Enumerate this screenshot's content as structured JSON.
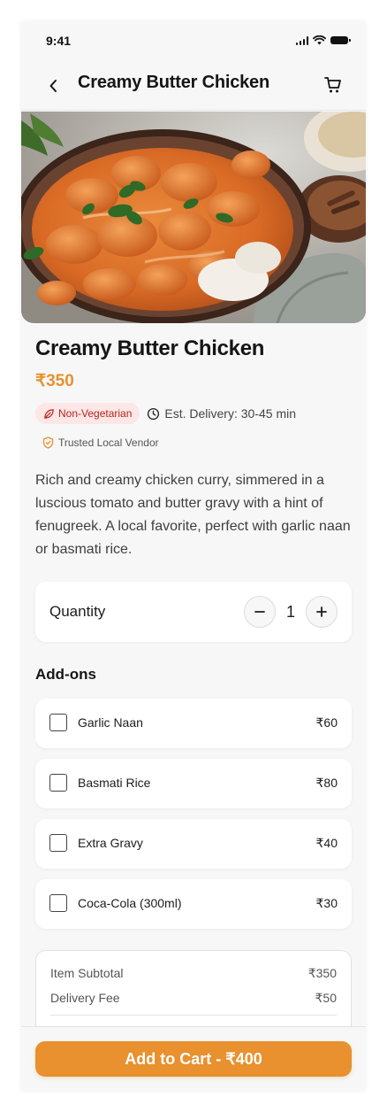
{
  "status_bar": {
    "time": "9:41"
  },
  "header": {
    "title": "Creamy Butter Chicken"
  },
  "dish": {
    "name": "Creamy Butter Chicken",
    "price": "₹350",
    "diet_badge": "Non-Vegetarian",
    "delivery": "Est. Delivery: 30-45 min",
    "vendor": "Trusted Local Vendor",
    "description": "Rich and creamy chicken curry, simmered in a luscious tomato and butter gravy with a hint of fenugreek. A local favorite, perfect with garlic naan or basmati rice."
  },
  "quantity": {
    "label": "Quantity",
    "value": "1"
  },
  "addons": {
    "title": "Add-ons",
    "items": [
      {
        "name": "Garlic Naan",
        "price": "₹60",
        "checked": false
      },
      {
        "name": "Basmati Rice",
        "price": "₹80",
        "checked": false
      },
      {
        "name": "Extra Gravy",
        "price": "₹40",
        "checked": false
      },
      {
        "name": "Coca-Cola (300ml)",
        "price": "₹30",
        "checked": false
      }
    ]
  },
  "summary": {
    "subtotal_label": "Item Subtotal",
    "subtotal_value": "₹350",
    "delivery_label": "Delivery Fee",
    "delivery_value": "₹50"
  },
  "cta": {
    "label": "Add to Cart - ₹400"
  },
  "colors": {
    "accent": "#e8912e",
    "badge_bg": "#fde6e6",
    "badge_text": "#b3261e",
    "background": "#f7f7f7"
  },
  "icons": [
    "back-arrow-icon",
    "cart-icon",
    "leaf-icon",
    "clock-icon",
    "shield-icon",
    "minus-icon",
    "plus-icon"
  ]
}
